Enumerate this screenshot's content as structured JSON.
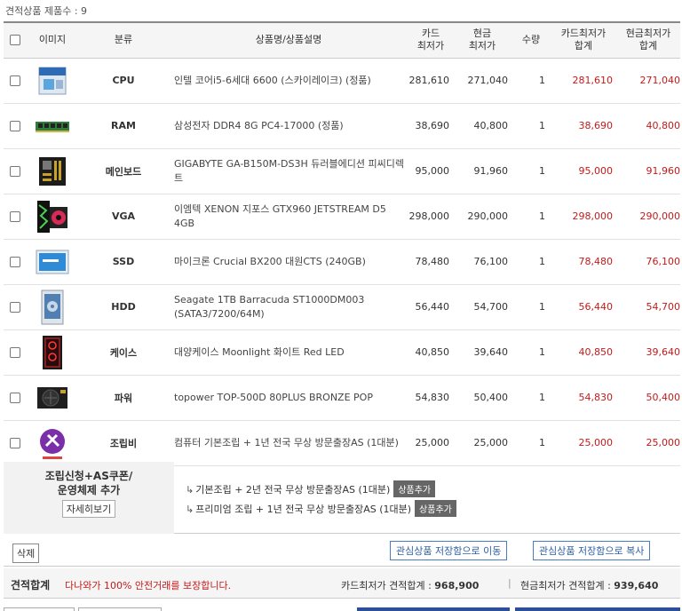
{
  "header": {
    "product_count_label": "견적상품 제품수 : 9"
  },
  "table": {
    "columns": {
      "image": "이미지",
      "category": "분류",
      "name": "상품명/상품설명",
      "card_low_1": "카드",
      "card_low_2": "최저가",
      "cash_low_1": "현금",
      "cash_low_2": "최저가",
      "qty": "수량",
      "card_total_1": "카드최저가",
      "card_total_2": "합계",
      "cash_total_1": "현금최저가",
      "cash_total_2": "합계"
    },
    "rows": [
      {
        "icon": "cpu-box-icon",
        "category": "CPU",
        "name": "인텔 코어i5-6세대 6600 (스카이레이크) (정품)",
        "card": "281,610",
        "cash": "271,040",
        "qty": "1",
        "card_total": "281,610",
        "cash_total": "271,040"
      },
      {
        "icon": "ram-stick-icon",
        "category": "RAM",
        "name": "삼성전자 DDR4 8G PC4-17000 (정품)",
        "card": "38,690",
        "cash": "40,800",
        "qty": "1",
        "card_total": "38,690",
        "cash_total": "40,800"
      },
      {
        "icon": "mainboard-icon",
        "category": "메인보드",
        "name": "GIGABYTE GA-B150M-DS3H 듀러블에디션 피씨디렉트",
        "card": "95,000",
        "cash": "91,960",
        "qty": "1",
        "card_total": "95,000",
        "cash_total": "91,960"
      },
      {
        "icon": "graphics-card-icon",
        "category": "VGA",
        "name": "이엠텍 XENON 지포스 GTX960 JETSTREAM D5 4GB",
        "card": "298,000",
        "cash": "290,000",
        "qty": "1",
        "card_total": "298,000",
        "cash_total": "290,000"
      },
      {
        "icon": "ssd-icon",
        "category": "SSD",
        "name": "마이크론 Crucial BX200 대원CTS (240GB)",
        "card": "78,480",
        "cash": "76,100",
        "qty": "1",
        "card_total": "78,480",
        "cash_total": "76,100"
      },
      {
        "icon": "hdd-icon",
        "category": "HDD",
        "name": "Seagate 1TB Barracuda ST1000DM003 (SATA3/7200/64M)",
        "card": "56,440",
        "cash": "54,700",
        "qty": "1",
        "card_total": "56,440",
        "cash_total": "54,700"
      },
      {
        "icon": "pc-case-icon",
        "category": "케이스",
        "name": "대양케이스 Moonlight 화이트 Red LED",
        "card": "40,850",
        "cash": "39,640",
        "qty": "1",
        "card_total": "40,850",
        "cash_total": "39,640"
      },
      {
        "icon": "power-supply-icon",
        "category": "파워",
        "name": "topower TOP-500D 80PLUS BRONZE POP",
        "card": "54,830",
        "cash": "50,400",
        "qty": "1",
        "card_total": "54,830",
        "cash_total": "50,400"
      },
      {
        "icon": "assembly-service-icon",
        "category": "조립비",
        "name": "컴퓨터 기본조립 + 1년 전국 무상 방문출장AS (1대분)",
        "card": "25,000",
        "cash": "25,000",
        "qty": "1",
        "card_total": "25,000",
        "cash_total": "25,000"
      }
    ]
  },
  "extra": {
    "title_line1": "조립신청+AS쿠폰/",
    "title_line2": "운영체제 추가",
    "detail_button": "자세히보기",
    "options": [
      {
        "label": "기본조립 + 2년 전국 무상 방문출장AS (1대분)",
        "button": "상품추가"
      },
      {
        "label": "프리미엄 조립 + 1년 전국 무상 방문출장AS (1대분)",
        "button": "상품추가"
      }
    ]
  },
  "actions": {
    "delete": "삭제",
    "save_move": "관심상품 저장함으로 이동",
    "save_copy": "관심상품 저장함으로 복사"
  },
  "totals": {
    "title": "견적합계",
    "notice": "다나와가 100% 안전거래를 보장합니다.",
    "card_label": "카드최저가 견적합계 :",
    "card_value": "968,900",
    "separator": "|",
    "cash_label": "현금최저가 견적합계 :",
    "cash_value": "939,640"
  },
  "colors": {
    "price_red": "#c41a1a",
    "link_blue": "#2d5fa8"
  }
}
